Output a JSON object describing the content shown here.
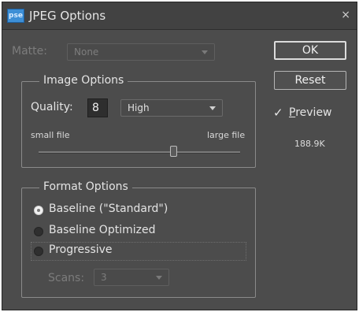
{
  "window": {
    "app_icon_text": "pse",
    "title": "JPEG Options",
    "close_glyph": "×"
  },
  "matte": {
    "label": "Matte:",
    "value": "None"
  },
  "image_options": {
    "title": "Image Options",
    "quality_label": "Quality:",
    "quality_value": "8",
    "quality_preset": "High",
    "small_file_label": "small file",
    "large_file_label": "large file",
    "slider_fraction": 0.67
  },
  "format_options": {
    "title": "Format Options",
    "options": [
      {
        "label": "Baseline (\"Standard\")",
        "selected": true
      },
      {
        "label": "Baseline Optimized",
        "selected": false
      },
      {
        "label": "Progressive",
        "selected": false
      }
    ],
    "scans_label": "Scans:",
    "scans_value": "3"
  },
  "buttons": {
    "ok": "OK",
    "reset": "Reset"
  },
  "preview": {
    "check_glyph": "✓",
    "label_underlined": "P",
    "label_rest": "review",
    "checked": true
  },
  "file_size": "188.9K",
  "colors": {
    "dialog_bg": "#4c4c4c",
    "titlebar_bg": "#424242",
    "accent_icon": "#3d8fd6"
  }
}
